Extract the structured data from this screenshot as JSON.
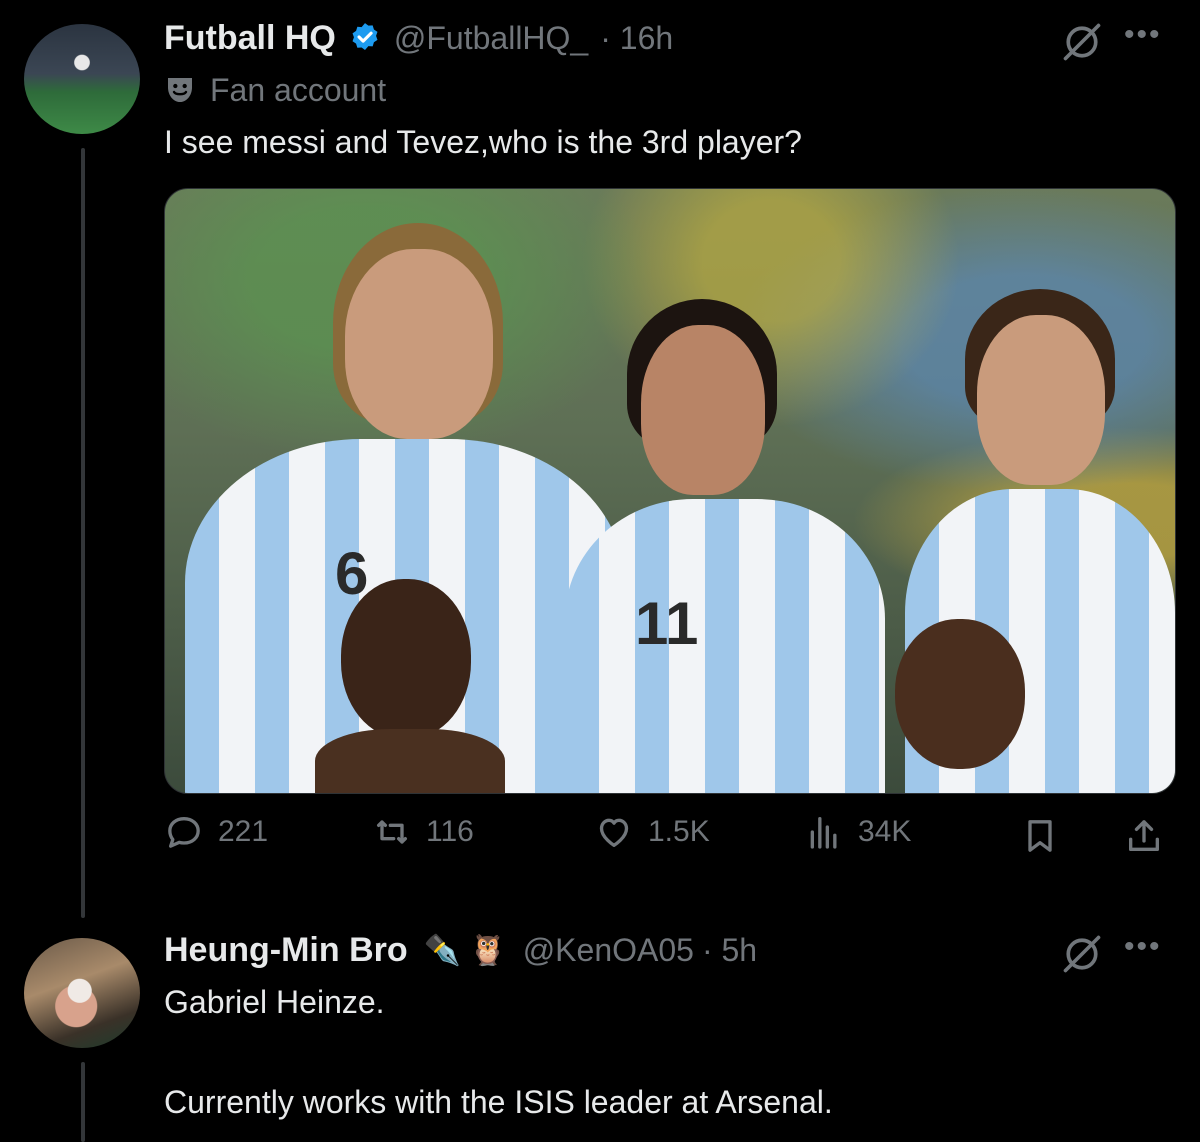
{
  "tweet1": {
    "display_name": "Futball HQ",
    "handle": "@FutballHQ_",
    "time": "· 16h",
    "fan_label": "Fan account",
    "text": "I see messi and Tevez,who is the 3rd player?",
    "jersey_number_left": "6",
    "jersey_number_mid": "11",
    "stats": {
      "replies": "221",
      "reposts": "116",
      "likes": "1.5K",
      "views": "34K"
    }
  },
  "tweet2": {
    "display_name": "Heung-Min Bro",
    "emojis": "✒️ 🦉",
    "handle": "@KenOA05",
    "time": "· 5h",
    "text_line1": "Gabriel Heinze.",
    "text_line2": "Currently works with the ISIS leader at Arsenal."
  },
  "icons": {
    "grok": "grok-icon",
    "more": "more-icon",
    "verified_color": "#1d9bf0",
    "muted_color": "#71767b"
  }
}
